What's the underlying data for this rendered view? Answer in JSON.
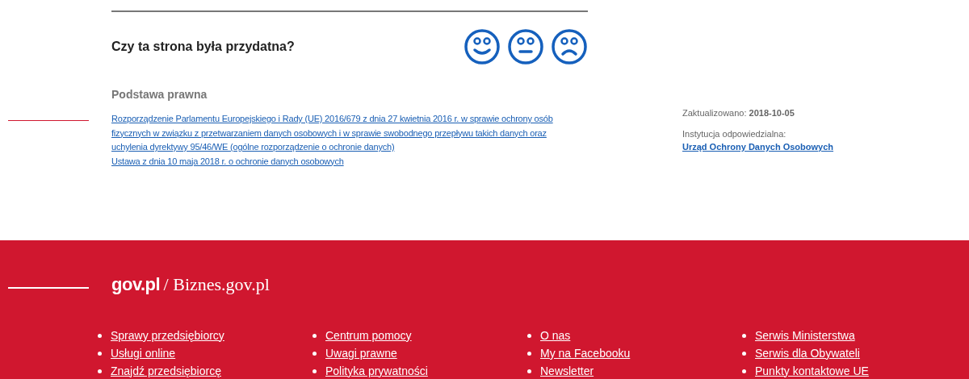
{
  "feedback": {
    "question": "Czy ta strona była przydatna?"
  },
  "legal_basis": {
    "heading": "Podstawa prawna",
    "links": [
      "Rozporządzenie Parlamentu Europejskiego i Rady (UE) 2016/679 z dnia 27 kwietnia 2016 r. w sprawie ochrony osób fizycznych w związku z przetwarzaniem danych osobowych i w sprawie swobodnego przepływu takich danych oraz uchylenia dyrektywy 95/46/WE (ogólne rozporządzenie o ochronie danych)",
      "Ustawa z dnia 10 maja 2018 r. o ochronie danych osobowych"
    ]
  },
  "meta": {
    "updated_label": "Zaktualizowano:",
    "updated_date": "2018-10-05",
    "institution_label": "Instytucja odpowiedzialna:",
    "institution_link": "Urząd Ochrony Danych Osobowych"
  },
  "footer": {
    "logo": {
      "brand": "gov.pl",
      "separator": "/",
      "site": "Biznes.gov.pl"
    },
    "columns": [
      [
        "Sprawy przedsiębiorcy",
        "Usługi online",
        "Znajdź przedsiębiorcę"
      ],
      [
        "Centrum pomocy",
        "Uwagi prawne",
        "Polityka prywatności"
      ],
      [
        "O nas",
        "My na Facebooku",
        "Newsletter"
      ],
      [
        "Serwis Ministerstwa",
        "Serwis dla Obywateli",
        "Punkty kontaktowe UE"
      ]
    ]
  }
}
